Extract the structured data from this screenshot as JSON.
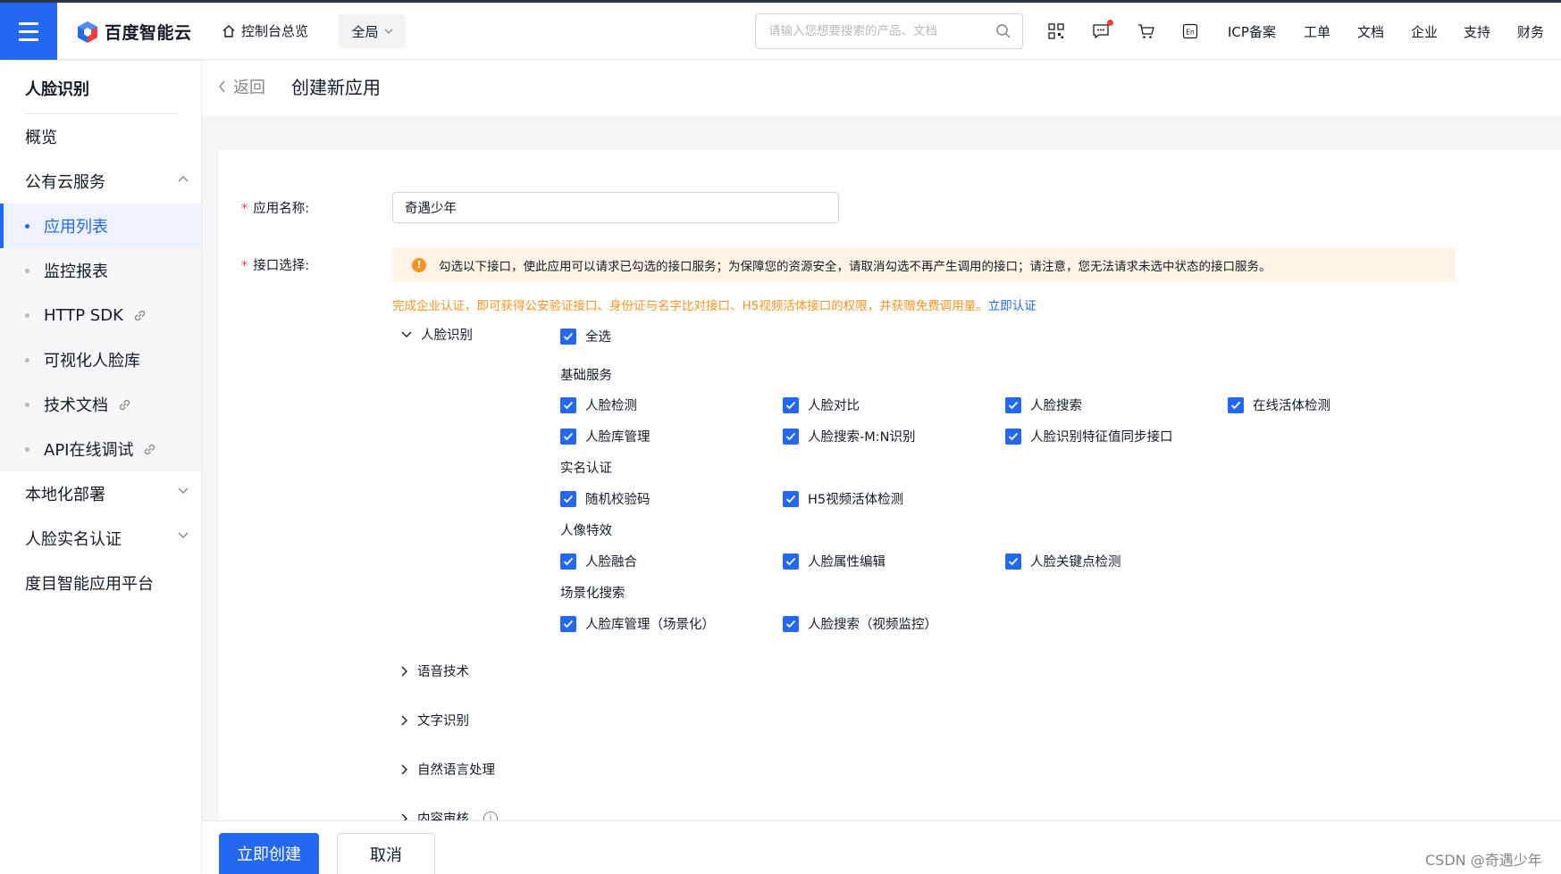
{
  "header": {
    "logo_text": "百度智能云",
    "home_label": "控制台总览",
    "region_label": "全局",
    "search_placeholder": "请输入您想要搜索的产品、文档",
    "nav": [
      "ICP备案",
      "工单",
      "文档",
      "企业",
      "支持",
      "财务"
    ]
  },
  "sidebar": {
    "title": "人脸识别",
    "items": [
      {
        "label": "概览"
      },
      {
        "label": "公有云服务"
      },
      {
        "label": "应用列表"
      },
      {
        "label": "监控报表"
      },
      {
        "label": "HTTP SDK"
      },
      {
        "label": "可视化人脸库"
      },
      {
        "label": "技术文档"
      },
      {
        "label": "API在线调试"
      },
      {
        "label": "本地化部署"
      },
      {
        "label": "人脸实名认证"
      },
      {
        "label": "度目智能应用平台"
      }
    ]
  },
  "page": {
    "back_label": "返回",
    "title": "创建新应用"
  },
  "form": {
    "name_label": "应用名称:",
    "name_value": "奇遇少年",
    "api_label": "接口选择:",
    "notice": "勾选以下接口，使此应用可以请求已勾选的接口服务；为保障您的资源安全，请取消勾选不再产生调用的接口；请注意，您无法请求未选中状态的接口服务。",
    "tip": "完成企业认证，即可获得公安验证接口、身份证与名字比对接口、H5视频活体接口的权限，并获赠免费调用量。",
    "tip_link": "立即认证",
    "group_face": "人脸识别",
    "select_all": "全选",
    "categories": [
      "基础服务",
      "实名认证",
      "人像特效",
      "场景化搜索"
    ],
    "checks": [
      "人脸检测",
      "人脸对比",
      "人脸搜索",
      "在线活体检测",
      "人脸库管理",
      "人脸搜索-M:N识别",
      "人脸识别特征值同步接口",
      "随机校验码",
      "H5视频活体检测",
      "人脸融合",
      "人脸属性编辑",
      "人脸关键点检测",
      "人脸库管理（场景化）",
      "人脸搜索（视频监控）"
    ],
    "collapsed_groups": [
      "语音技术",
      "文字识别",
      "自然语言处理",
      "内容审核"
    ]
  },
  "footer": {
    "create_label": "立即创建",
    "cancel_label": "取消"
  },
  "watermark": "CSDN @奇遇少年",
  "colors": {
    "accent": "#2468f2",
    "warning": "#ff9326",
    "required": "#f33e3e"
  }
}
